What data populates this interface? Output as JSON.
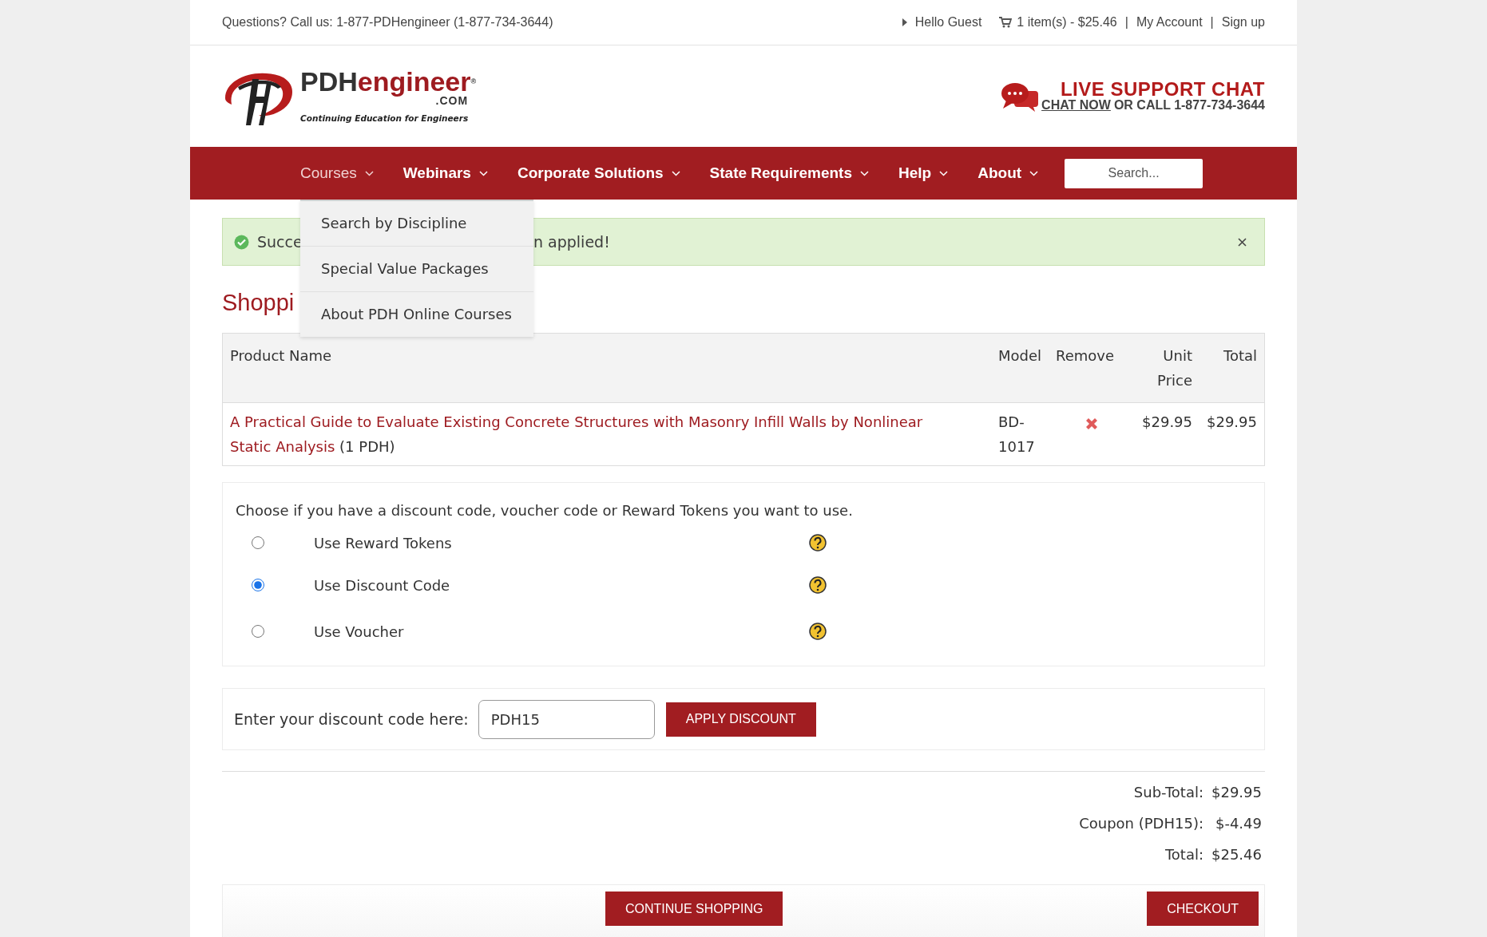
{
  "top_bar": {
    "contact": "Questions? Call us: 1-877-PDHengineer (1-877-734-3644)",
    "greeting": "Hello Guest",
    "cart": "1 item(s) - $25.46",
    "links": [
      {
        "separator": "|",
        "label": "My Account"
      },
      {
        "separator": "|",
        "label": "Sign up"
      }
    ]
  },
  "logo": {
    "name_dark": "PDH",
    "name_accent": "engineer",
    "mark": "®",
    "suffix": ".COM",
    "tagline": "Continuing Education for Engineers"
  },
  "live_chat": {
    "title": "LIVE SUPPORT CHAT",
    "link": "CHAT NOW",
    "text": "OR CALL 1-877-734-3644"
  },
  "nav": {
    "items": [
      {
        "label": "Courses",
        "selected": true,
        "menu": [
          "Search by Discipline",
          "Special Value Packages",
          "About PDH Online Courses"
        ]
      },
      {
        "label": "Webinars",
        "selected": false
      },
      {
        "label": "Corporate Solutions",
        "selected": false
      },
      {
        "label": "State Requirements",
        "selected": false
      },
      {
        "label": "Help",
        "selected": false
      },
      {
        "label": "About",
        "selected": false
      }
    ],
    "search": {
      "placeholder": "Search..."
    }
  },
  "alert": {
    "text_start": "Succe",
    "text_end": "n applied!"
  },
  "heading": "Shoppi",
  "table": {
    "columns": [
      "Product Name",
      "Model",
      "Remove",
      "Unit Price",
      "Total"
    ],
    "rows": [
      {
        "product": "A Practical Guide to Evaluate Existing Concrete Structures with Masonry Infill Walls by Nonlinear Static Analysis",
        "hours": "(1 PDH)",
        "model": "BD-1017",
        "unit_price": "$29.95",
        "total": "$29.95"
      }
    ]
  },
  "discount": {
    "prompt": "Choose if you have a discount code, voucher code or Reward Tokens you want to use.",
    "options": [
      {
        "label": "Use Reward Tokens",
        "selected": false
      },
      {
        "label": "Use Discount Code",
        "selected": true
      },
      {
        "label": "Use Voucher",
        "selected": false
      }
    ]
  },
  "code_entry": {
    "label": "Enter your discount code here:",
    "value": "PDH15",
    "button": "APPLY DISCOUNT"
  },
  "totals": [
    {
      "label": "Sub-Total:",
      "value": "$29.95"
    },
    {
      "label": "Coupon (PDH15):",
      "value": "$-4.49"
    },
    {
      "label": "Total:",
      "value": "$25.46"
    }
  ],
  "buttons": [
    "CONTINUE SHOPPING",
    "CHECKOUT"
  ]
}
